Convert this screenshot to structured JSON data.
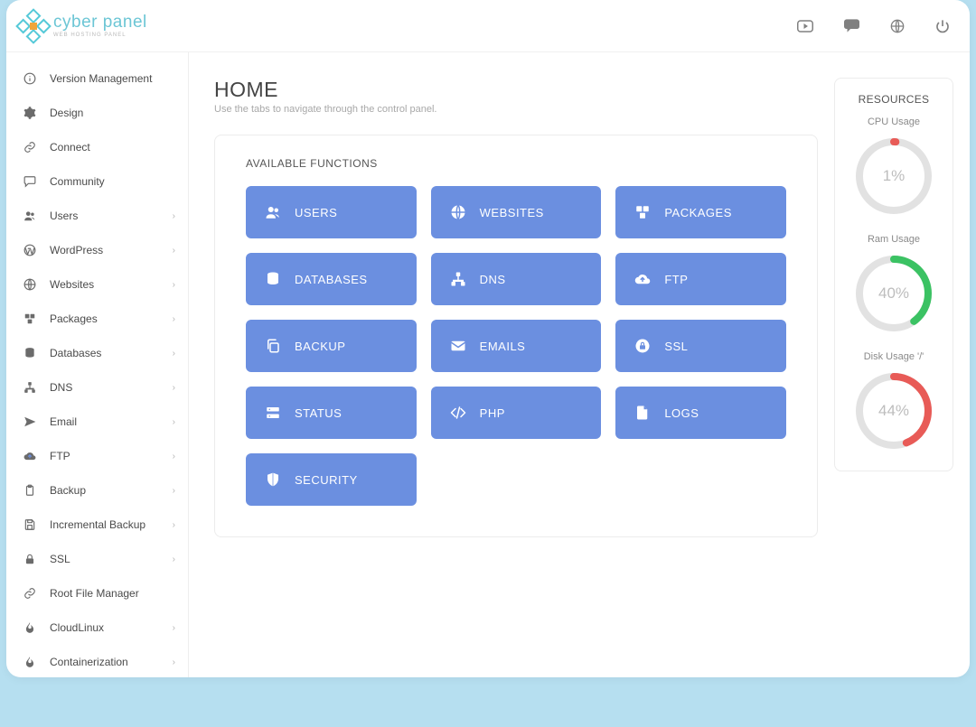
{
  "brand": {
    "name": "cyber panel",
    "sub": "WEB HOSTING PANEL"
  },
  "page": {
    "title": "HOME",
    "sub": "Use the tabs to navigate through the control panel."
  },
  "panel": {
    "title": "AVAILABLE FUNCTIONS"
  },
  "funcs": [
    {
      "label": "USERS",
      "icon": "users"
    },
    {
      "label": "WEBSITES",
      "icon": "globe"
    },
    {
      "label": "PACKAGES",
      "icon": "boxes"
    },
    {
      "label": "DATABASES",
      "icon": "database"
    },
    {
      "label": "DNS",
      "icon": "sitemap"
    },
    {
      "label": "FTP",
      "icon": "cloud-up"
    },
    {
      "label": "BACKUP",
      "icon": "copy"
    },
    {
      "label": "EMAILS",
      "icon": "envelope"
    },
    {
      "label": "SSL",
      "icon": "lock-circle"
    },
    {
      "label": "STATUS",
      "icon": "server"
    },
    {
      "label": "PHP",
      "icon": "code"
    },
    {
      "label": "LOGS",
      "icon": "file"
    },
    {
      "label": "SECURITY",
      "icon": "shield"
    }
  ],
  "nav": [
    {
      "label": "Version Management",
      "icon": "info",
      "expand": false
    },
    {
      "label": "Design",
      "icon": "gear",
      "expand": false
    },
    {
      "label": "Connect",
      "icon": "link",
      "expand": false
    },
    {
      "label": "Community",
      "icon": "comment",
      "expand": false
    },
    {
      "label": "Users",
      "icon": "users",
      "expand": true
    },
    {
      "label": "WordPress",
      "icon": "wordpress",
      "expand": true
    },
    {
      "label": "Websites",
      "icon": "globe",
      "expand": true
    },
    {
      "label": "Packages",
      "icon": "boxes",
      "expand": true
    },
    {
      "label": "Databases",
      "icon": "database",
      "expand": true
    },
    {
      "label": "DNS",
      "icon": "sitemap",
      "expand": true
    },
    {
      "label": "Email",
      "icon": "send",
      "expand": true
    },
    {
      "label": "FTP",
      "icon": "cloud-up",
      "expand": true
    },
    {
      "label": "Backup",
      "icon": "clipboard",
      "expand": true
    },
    {
      "label": "Incremental Backup",
      "icon": "save",
      "expand": true
    },
    {
      "label": "SSL",
      "icon": "lock",
      "expand": true
    },
    {
      "label": "Root File Manager",
      "icon": "link",
      "expand": false
    },
    {
      "label": "CloudLinux",
      "icon": "flame",
      "expand": true
    },
    {
      "label": "Containerization",
      "icon": "flame",
      "expand": true
    }
  ],
  "resources": {
    "title": "RESOURCES",
    "gauges": [
      {
        "label": "CPU Usage",
        "pct": 1,
        "color": "#e85b57"
      },
      {
        "label": "Ram Usage",
        "pct": 40,
        "color": "#3bc263"
      },
      {
        "label": "Disk Usage '/'",
        "pct": 44,
        "color": "#e85b57"
      }
    ]
  }
}
